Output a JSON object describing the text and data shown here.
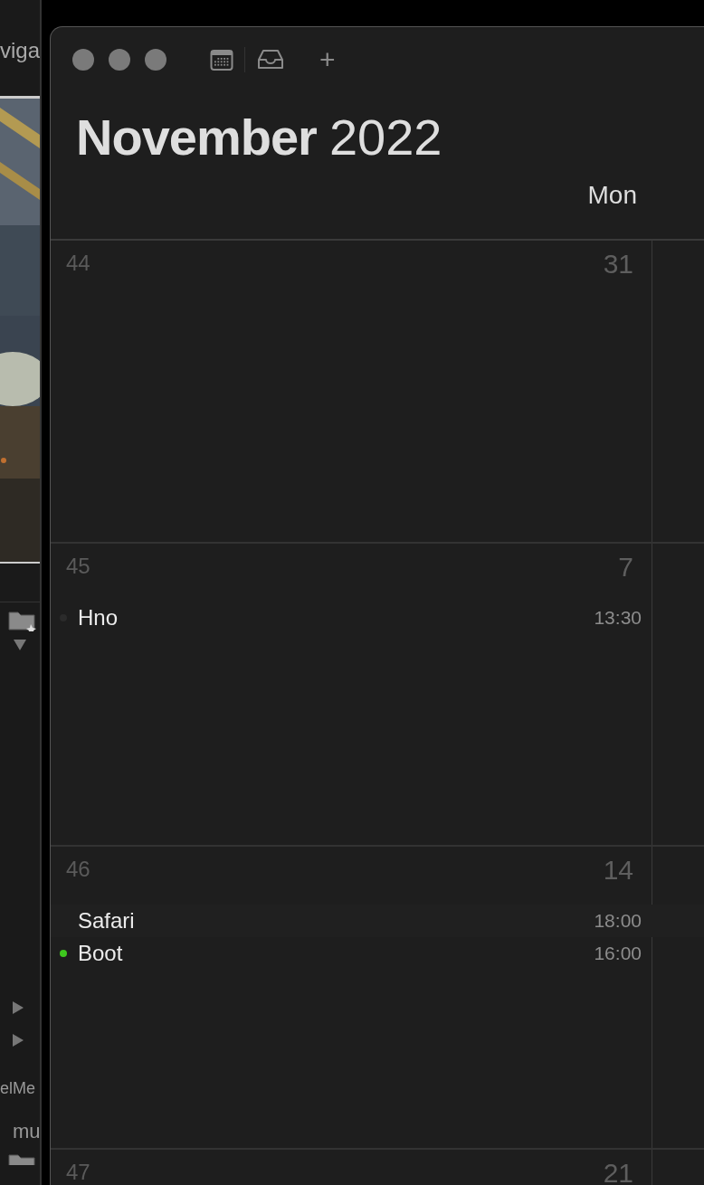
{
  "background_app": {
    "tab_label": "viga",
    "panel_label": "elMe",
    "field_label": "mu"
  },
  "window": {
    "toolbar": {
      "buttons": [
        "+"
      ]
    },
    "title": {
      "month": "November",
      "year": "2022"
    }
  },
  "columns": [
    "Mon"
  ],
  "weeks": [
    {
      "week": "44",
      "day": "31"
    },
    {
      "week": "45",
      "day": "7",
      "events": [
        {
          "title": "Hno",
          "time": "13:30",
          "color": "#2b2b2b",
          "selected": false
        }
      ]
    },
    {
      "week": "46",
      "day": "14",
      "events": [
        {
          "title": "Safari",
          "time": "18:00",
          "selected": true
        },
        {
          "title": "Boot",
          "time": "16:00",
          "color": "#3ec71e",
          "selected": false
        }
      ]
    },
    {
      "week": "47",
      "day": "21"
    }
  ]
}
